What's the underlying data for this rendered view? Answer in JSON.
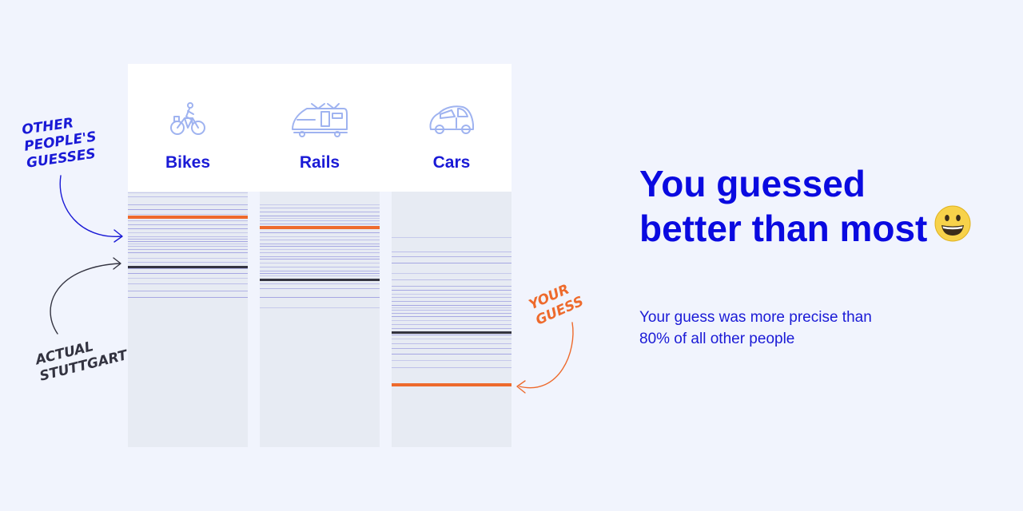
{
  "chart_data": {
    "type": "strip",
    "columns": [
      {
        "label": "Bikes",
        "icon": "bicycle-icon",
        "your_guess": 0.1,
        "actual": 0.295,
        "others": [
          0.005,
          0.02,
          0.05,
          0.07,
          0.09,
          0.115,
          0.13,
          0.145,
          0.16,
          0.175,
          0.185,
          0.195,
          0.205,
          0.215,
          0.225,
          0.24,
          0.26,
          0.275,
          0.3,
          0.32,
          0.34,
          0.36,
          0.39,
          0.415
        ]
      },
      {
        "label": "Rails",
        "icon": "train-icon",
        "your_guess": 0.14,
        "actual": 0.345,
        "others": [
          0.05,
          0.065,
          0.08,
          0.095,
          0.105,
          0.115,
          0.125,
          0.16,
          0.175,
          0.19,
          0.205,
          0.215,
          0.225,
          0.24,
          0.255,
          0.265,
          0.28,
          0.295,
          0.31,
          0.32,
          0.33,
          0.36,
          0.38,
          0.415,
          0.455
        ]
      },
      {
        "label": "Cars",
        "icon": "car-icon",
        "your_guess": 0.755,
        "actual": 0.55,
        "others": [
          0.18,
          0.235,
          0.255,
          0.28,
          0.32,
          0.345,
          0.37,
          0.385,
          0.4,
          0.415,
          0.43,
          0.445,
          0.455,
          0.465,
          0.475,
          0.49,
          0.505,
          0.52,
          0.535,
          0.56,
          0.575,
          0.595,
          0.615,
          0.635,
          0.66,
          0.69
        ]
      }
    ]
  },
  "annotations": {
    "others": "OTHER\nPEOPLE'S\nGUESSES",
    "actual": "ACTUAL\nSTUTTGART",
    "yours": "YOUR\nGUESS"
  },
  "result": {
    "headline": "You guessed better than most",
    "emoji": "grinning-face-icon",
    "subtext": "Your guess was more precise than 80% of all other people"
  },
  "colors": {
    "accent": "#0a0ae0",
    "your_guess": "#ee6a2c",
    "actual": "#333340",
    "others": "#8c8cdc",
    "column_bg": "#e7ebf3",
    "page_bg": "#f1f4fd"
  }
}
